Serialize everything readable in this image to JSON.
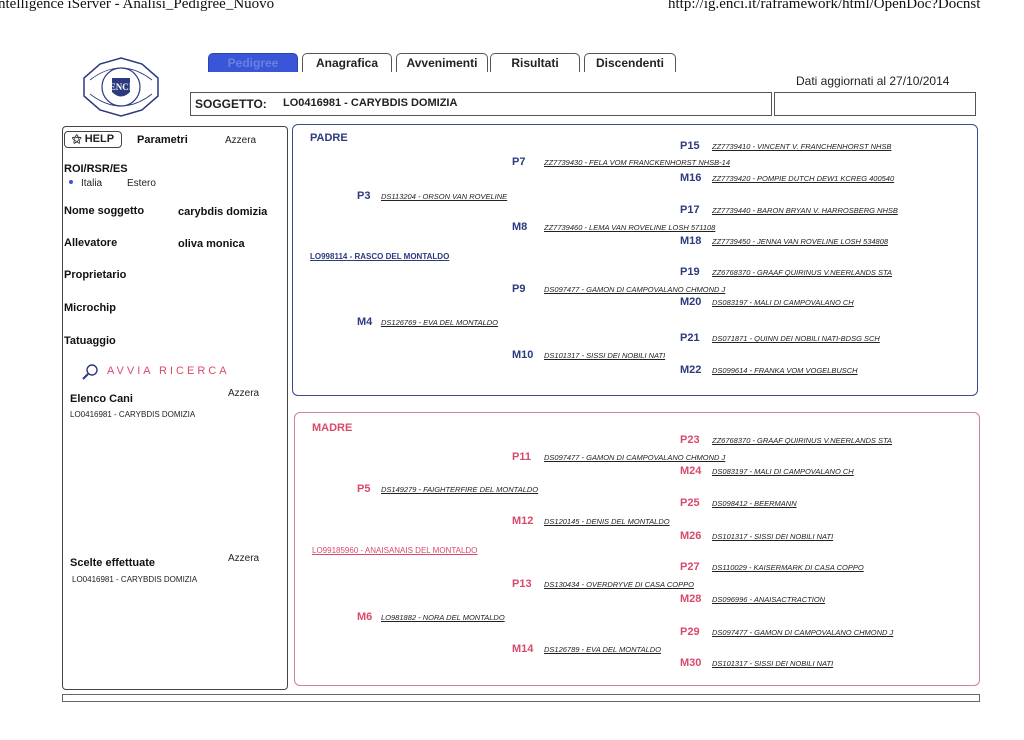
{
  "header": {
    "left_title": "ntelligence iServer - Analisi_Pedigree_Nuovo",
    "right_url": "http://ig.enci.it/raframework/html/OpenDoc?Docnst"
  },
  "tabs": [
    "Pedigree",
    "Anagrafica",
    "Avvenimenti",
    "Risultati",
    "Discendenti"
  ],
  "updated_text": "Dati aggiornati al 27/10/2014",
  "subject": {
    "label": "SOGGETTO:",
    "value": "LO0416981 - CARYBDIS DOMIZIA"
  },
  "left_panel": {
    "help": "HELP",
    "parametri": "Parametri",
    "azzera": "Azzera",
    "roi_label": "ROI/RSR/ES",
    "italia": "Italia",
    "estero": "Estero",
    "nome_label": "Nome soggetto",
    "nome_value": "carybdis domizia",
    "allevatore_label": "Allevatore",
    "allevatore_value": "oliva monica",
    "proprietario_label": "Proprietario",
    "microchip_label": "Microchip",
    "tatuaggio_label": "Tatuaggio",
    "avvia": "AVVIA RICERCA",
    "elenco_label": "Elenco Cani",
    "elenco_azzera": "Azzera",
    "elenco_item": "LO0416981 - CARYBDIS DOMIZIA",
    "scelte_label": "Scelte effettuate",
    "scelte_azzera": "Azzera",
    "scelte_item": "LO0416981 - CARYBDIS DOMIZIA"
  },
  "padre": {
    "title": "PADRE",
    "sire": "LO998114 - RASCO DEL MONTALDO",
    "ancestors": [
      {
        "code": "P15",
        "name": "ZZ7739410 - VINCENT V. FRANCHENHORST NHSB"
      },
      {
        "code": "P7",
        "name": "ZZ7739430 - FELA VOM FRANCKENHORST NHSB-14"
      },
      {
        "code": "M16",
        "name": "ZZ7739420 - POMPIE DUTCH DEW1 KCREG 400540"
      },
      {
        "code": "P3",
        "name": "DS113204 - ORSON VAN ROVELINE"
      },
      {
        "code": "P17",
        "name": "ZZ7739440 - BARON BRYAN V. HARROSBERG NHSB"
      },
      {
        "code": "M8",
        "name": "ZZ7739460 - LEMA VAN ROVELINE LOSH 571108"
      },
      {
        "code": "M18",
        "name": "ZZ7739450 - JENNA VAN ROVELINE LOSH 534808"
      },
      {
        "code": "P19",
        "name": "ZZ6768370 - GRAAF QUIRINUS V.NEERLANDS STA"
      },
      {
        "code": "P9",
        "name": "DS097477 - GAMON DI CAMPOVALANO CHMOND J"
      },
      {
        "code": "M20",
        "name": "DS083197 - MALI DI CAMPOVALANO CH"
      },
      {
        "code": "M4",
        "name": "DS126769 - EVA DEL MONTALDO"
      },
      {
        "code": "P21",
        "name": "DS071871 - QUINN DEI NOBILI NATI-BDSG SCH"
      },
      {
        "code": "M10",
        "name": "DS101317 - SISSI DEI NOBILI NATI"
      },
      {
        "code": "M22",
        "name": "DS099614 - FRANKA VOM VOGELBUSCH"
      }
    ]
  },
  "madre": {
    "title": "MADRE",
    "dam": "LO99185960 - ANAISANAIS DEL MONTALDO",
    "ancestors": [
      {
        "code": "P23",
        "name": "ZZ6768370 - GRAAF QUIRINUS V.NEERLANDS STA"
      },
      {
        "code": "P11",
        "name": "DS097477 - GAMON DI CAMPOVALANO CHMOND J"
      },
      {
        "code": "M24",
        "name": "DS083197 - MALI DI CAMPOVALANO CH"
      },
      {
        "code": "P5",
        "name": "DS149279 - FAIGHTERFIRE DEL MONTALDO"
      },
      {
        "code": "P25",
        "name": "DS098412 - BEERMANN"
      },
      {
        "code": "M12",
        "name": "DS120145 - DENIS DEL MONTALDO"
      },
      {
        "code": "M26",
        "name": "DS101317 - SISSI DEI NOBILI NATI"
      },
      {
        "code": "P27",
        "name": "DS110029 - KAISERMARK DI CASA COPPO"
      },
      {
        "code": "P13",
        "name": "DS130434 - OVERDRYVE DI CASA COPPO"
      },
      {
        "code": "M28",
        "name": "DS096996 - ANAISACTRACTION"
      },
      {
        "code": "M6",
        "name": "LO981882 - NORA DEL MONTALDO"
      },
      {
        "code": "P29",
        "name": "DS097477 - GAMON DI CAMPOVALANO CHMOND J"
      },
      {
        "code": "M14",
        "name": "DS126789 - EVA DEL MONTALDO"
      },
      {
        "code": "M30",
        "name": "DS101317 - SISSI DEI NOBILI NATI"
      }
    ]
  },
  "colors": {
    "padre": "#2c3a7e",
    "madre": "#d94a6a",
    "tab_active": "#3a56d8"
  },
  "icons": [
    "logo-emblem",
    "help-icon",
    "search-magnifier-icon",
    "radio-dot-icon"
  ]
}
